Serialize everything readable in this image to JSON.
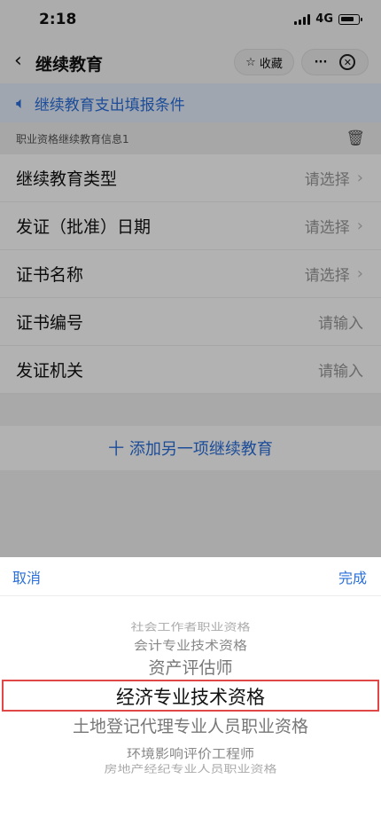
{
  "status": {
    "time": "2:18",
    "network": "4G"
  },
  "nav": {
    "title": "继续教育",
    "favorite_label": "收藏",
    "more_icon": "···"
  },
  "notice": {
    "text": "继续教育支出填报条件"
  },
  "section": {
    "title": "职业资格继续教育信息1"
  },
  "form": {
    "rows": [
      {
        "label": "继续教育类型",
        "value": "请选择"
      },
      {
        "label": "发证（批准）日期",
        "value": "请选择"
      },
      {
        "label": "证书名称",
        "value": "请选择"
      },
      {
        "label": "证书编号",
        "value": "请输入"
      },
      {
        "label": "发证机关",
        "value": "请输入"
      }
    ]
  },
  "add_button": {
    "label": "十 添加另一项继续教育"
  },
  "picker": {
    "cancel_label": "取消",
    "done_label": "完成",
    "options": [
      "",
      "社会工作者职业资格",
      "会计专业技术资格",
      "资产评估师",
      "经济专业技术资格",
      "土地登记代理专业人员职业资格",
      "环境影响评价工程师",
      "房地产经纪专业人员职业资格",
      ""
    ],
    "selected": "经济专业技术资格"
  },
  "colors": {
    "accent": "#2a6fdb",
    "highlight_border": "#e04848"
  }
}
